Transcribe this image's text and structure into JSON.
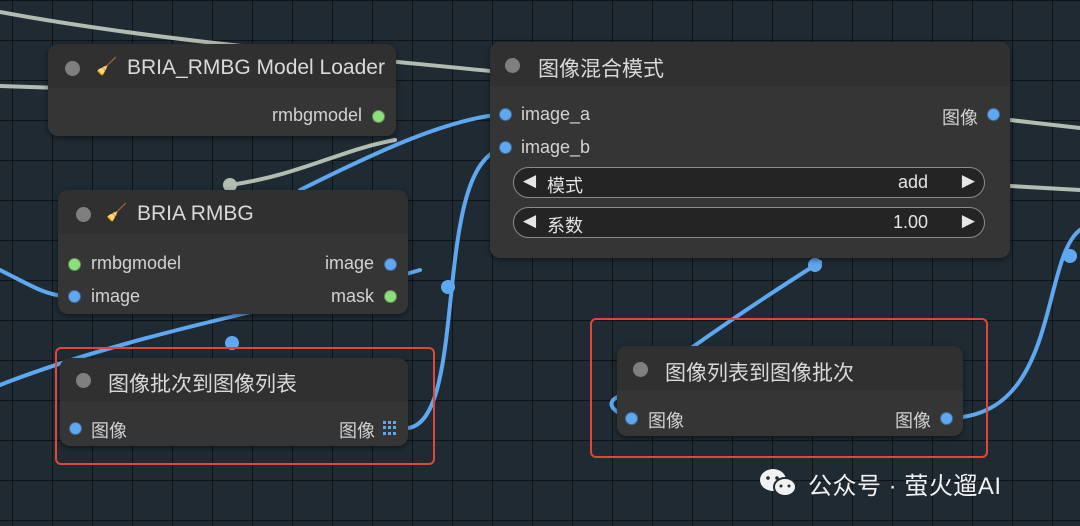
{
  "canvas": {
    "background": "#1f2a33",
    "link_color_image": "#5fa8f0",
    "link_color_model": "#b3bcb1"
  },
  "nodes": {
    "model_loader": {
      "title": "BRIA_RMBG Model Loader",
      "icon": "broom-icon",
      "outputs": [
        "rmbgmodel"
      ]
    },
    "rmbg": {
      "title": "BRIA RMBG",
      "icon": "broom-icon",
      "inputs": [
        "rmbgmodel",
        "image"
      ],
      "outputs": [
        "image",
        "mask"
      ]
    },
    "batch_to_list": {
      "title": "图像批次到图像列表",
      "inputs": [
        "图像"
      ],
      "outputs": [
        "图像"
      ]
    },
    "blend": {
      "title": "图像混合模式",
      "inputs": [
        "image_a",
        "image_b"
      ],
      "outputs": [
        "图像"
      ],
      "widgets": [
        {
          "label": "模式",
          "value": "add"
        },
        {
          "label": "系数",
          "value": "1.00"
        }
      ]
    },
    "list_to_batch": {
      "title": "图像列表到图像批次",
      "inputs": [
        "图像"
      ],
      "outputs": [
        "图像"
      ]
    }
  },
  "watermark": {
    "text": "公众号 · 萤火遛AI",
    "icon": "wechat-icon"
  },
  "highlight_color": "#e0473a"
}
